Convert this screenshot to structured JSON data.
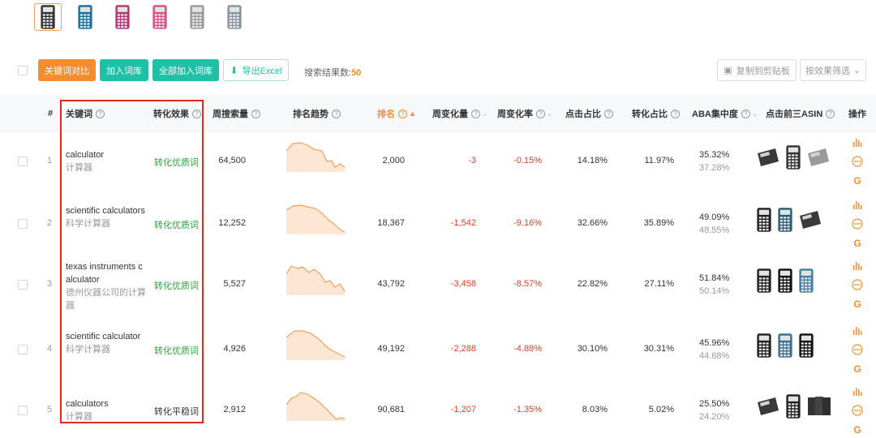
{
  "thumbs": [
    {
      "color": "#333333",
      "active": true
    },
    {
      "color": "#1f6f9e",
      "active": false
    },
    {
      "color": "#b03a78",
      "active": false
    },
    {
      "color": "#d94f8a",
      "active": false
    },
    {
      "color": "#9a9a9a",
      "active": false
    },
    {
      "color": "#8a93a3",
      "active": false
    }
  ],
  "toolbar": {
    "compare_label": "关键词对比",
    "add_label": "加入词库",
    "add_all_label": "全部加入词库",
    "export_label": "导出Excel",
    "result_prefix": "搜索结果数:",
    "result_count": "50",
    "copy_label": "复制到剪贴板",
    "filter_label": "按效果筛选"
  },
  "headers": {
    "index": "#",
    "keyword": "关键词",
    "effect": "转化效果",
    "volume": "周搜索量",
    "trend": "排名趋势",
    "rank": "排名",
    "wchange": "周变化量",
    "wrate": "周变化率",
    "click": "点击占比",
    "conv": "转化占比",
    "aba": "ABA集中度",
    "asin": "点击前三ASIN",
    "ops": "操作"
  },
  "rows": [
    {
      "index": "1",
      "keyword": "calculator",
      "keyword_zh": "计算器",
      "effect": "转化优质词",
      "effect_color": "green",
      "volume": "64,500",
      "rank": "2,000",
      "wchange": "-3",
      "wrate": "-0.15%",
      "click": "14.18%",
      "conv": "11.97%",
      "aba1": "35.32%",
      "aba2": "37.28%"
    },
    {
      "index": "2",
      "keyword": "scientific calculators",
      "keyword_zh": "科学计算器",
      "effect": "转化优质词",
      "effect_color": "green",
      "volume": "12,252",
      "rank": "18,367",
      "wchange": "-1,542",
      "wrate": "-9.16%",
      "click": "32.66%",
      "conv": "35.89%",
      "aba1": "49.09%",
      "aba2": "48.55%"
    },
    {
      "index": "3",
      "keyword": "texas instruments calculator",
      "keyword_zh": "德州仪器公司的计算器",
      "effect": "转化优质词",
      "effect_color": "green",
      "volume": "5,527",
      "rank": "43,792",
      "wchange": "-3,458",
      "wrate": "-8.57%",
      "click": "22.82%",
      "conv": "27.11%",
      "aba1": "51.84%",
      "aba2": "50.14%"
    },
    {
      "index": "4",
      "keyword": "scientific calculator",
      "keyword_zh": "科学计算器",
      "effect": "转化优质词",
      "effect_color": "green",
      "volume": "4,926",
      "rank": "49,192",
      "wchange": "-2,288",
      "wrate": "-4.88%",
      "click": "30.10%",
      "conv": "30.31%",
      "aba1": "45.96%",
      "aba2": "44.68%"
    },
    {
      "index": "5",
      "keyword": "calculators",
      "keyword_zh": "计算器",
      "effect": "转化平稳词",
      "effect_color": "dark",
      "volume": "2,912",
      "rank": "90,681",
      "wchange": "-1,207",
      "wrate": "-1.35%",
      "click": "8.03%",
      "conv": "5.02%",
      "aba1": "25.50%",
      "aba2": "24.20%"
    }
  ],
  "icons": {
    "chart": "bar-chart-icon",
    "more": "more-icon",
    "google": "google-icon"
  },
  "colors": {
    "orange": "#f58c2e",
    "teal": "#1ec0a6",
    "red": "#e03c1f",
    "green": "#2aa53a",
    "highlight": "#e02a1f"
  }
}
